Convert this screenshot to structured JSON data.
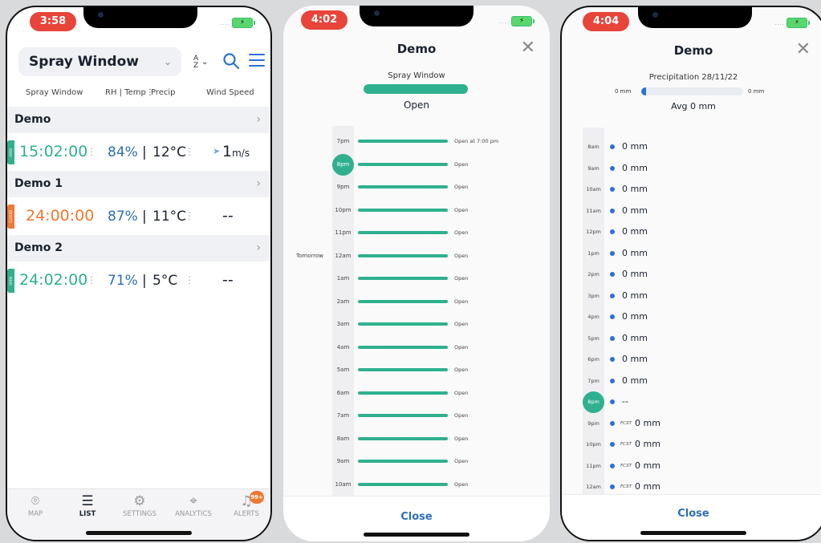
{
  "phone1": {
    "time": "3:58",
    "title": "Spray Window",
    "sort_glyph": "A/Z",
    "columns": [
      "Spray Window",
      "RH | Temp",
      "Precip",
      "Wind Speed"
    ],
    "groups": [
      {
        "name": "Demo",
        "status": "OPEN",
        "status_color": "#2fb08e",
        "value": "15:02:00",
        "value_color": "#2fb08e",
        "rh": "84%",
        "temp": "12°C",
        "wind": "1",
        "wind_unit": "m/s"
      },
      {
        "name": "Demo 1",
        "status": "CLOSED",
        "status_color": "#f07832",
        "value": "24:00:00",
        "value_color": "#f07832",
        "rh": "87%",
        "temp": "11°C",
        "wind": "--",
        "wind_unit": ""
      },
      {
        "name": "Demo 2",
        "status": "OPEN",
        "status_color": "#2fb08e",
        "value": "24:02:00",
        "value_color": "#2fb08e",
        "rh": "71%",
        "temp": "5°C",
        "wind": "--",
        "wind_unit": ""
      }
    ],
    "nav": [
      {
        "label": "MAP",
        "icon": "map-pin-icon"
      },
      {
        "label": "LIST",
        "icon": "list-icon"
      },
      {
        "label": "SETTINGS",
        "icon": "gear-icon"
      },
      {
        "label": "ANALYTICS",
        "icon": "crosshair-icon"
      },
      {
        "label": "ALERTS",
        "icon": "bell-icon"
      }
    ],
    "alert_badge": "99+"
  },
  "phone2": {
    "time": "4:02",
    "title": "Demo",
    "spray_label": "Spray Window",
    "state": "Open",
    "tomorrow_label": "Tomorrow",
    "hours": [
      {
        "h": "7pm",
        "s": "Open at 7:00 pm"
      },
      {
        "h": "8pm",
        "s": "Open",
        "cur": true
      },
      {
        "h": "9pm",
        "s": "Open"
      },
      {
        "h": "10pm",
        "s": "Open"
      },
      {
        "h": "11pm",
        "s": "Open"
      },
      {
        "h": "12am",
        "s": "Open",
        "tomorrow": true
      },
      {
        "h": "1am",
        "s": "Open"
      },
      {
        "h": "2am",
        "s": "Open"
      },
      {
        "h": "3am",
        "s": "Open"
      },
      {
        "h": "4am",
        "s": "Open"
      },
      {
        "h": "5am",
        "s": "Open"
      },
      {
        "h": "6am",
        "s": "Open"
      },
      {
        "h": "7am",
        "s": "Open"
      },
      {
        "h": "8am",
        "s": "Open"
      },
      {
        "h": "9am",
        "s": "Open"
      },
      {
        "h": "10am",
        "s": "Open"
      }
    ],
    "close_label": "Close"
  },
  "phone3": {
    "time": "4:04",
    "title": "Demo",
    "precip_label": "Precipitation 28/11/22",
    "min_label": "0 mm",
    "max_label": "0 mm",
    "avg_label": "Avg 0  mm",
    "fcst_label": "FCST",
    "rows": [
      {
        "h": "8am",
        "v": "0 mm"
      },
      {
        "h": "9am",
        "v": "0 mm"
      },
      {
        "h": "10am",
        "v": "0 mm"
      },
      {
        "h": "11am",
        "v": "0 mm"
      },
      {
        "h": "12pm",
        "v": "0 mm"
      },
      {
        "h": "1pm",
        "v": "0 mm"
      },
      {
        "h": "2pm",
        "v": "0 mm"
      },
      {
        "h": "3pm",
        "v": "0 mm"
      },
      {
        "h": "4pm",
        "v": "0 mm"
      },
      {
        "h": "5pm",
        "v": "0 mm"
      },
      {
        "h": "6pm",
        "v": "0 mm"
      },
      {
        "h": "7pm",
        "v": "0 mm"
      },
      {
        "h": "8pm",
        "v": "--",
        "cur": true
      },
      {
        "h": "9pm",
        "v": "0 mm",
        "fcst": true
      },
      {
        "h": "10pm",
        "v": "0 mm",
        "fcst": true
      },
      {
        "h": "11pm",
        "v": "0 mm",
        "fcst": true
      },
      {
        "h": "12am",
        "v": "0 mm",
        "fcst": true
      }
    ],
    "close_label": "Close"
  }
}
